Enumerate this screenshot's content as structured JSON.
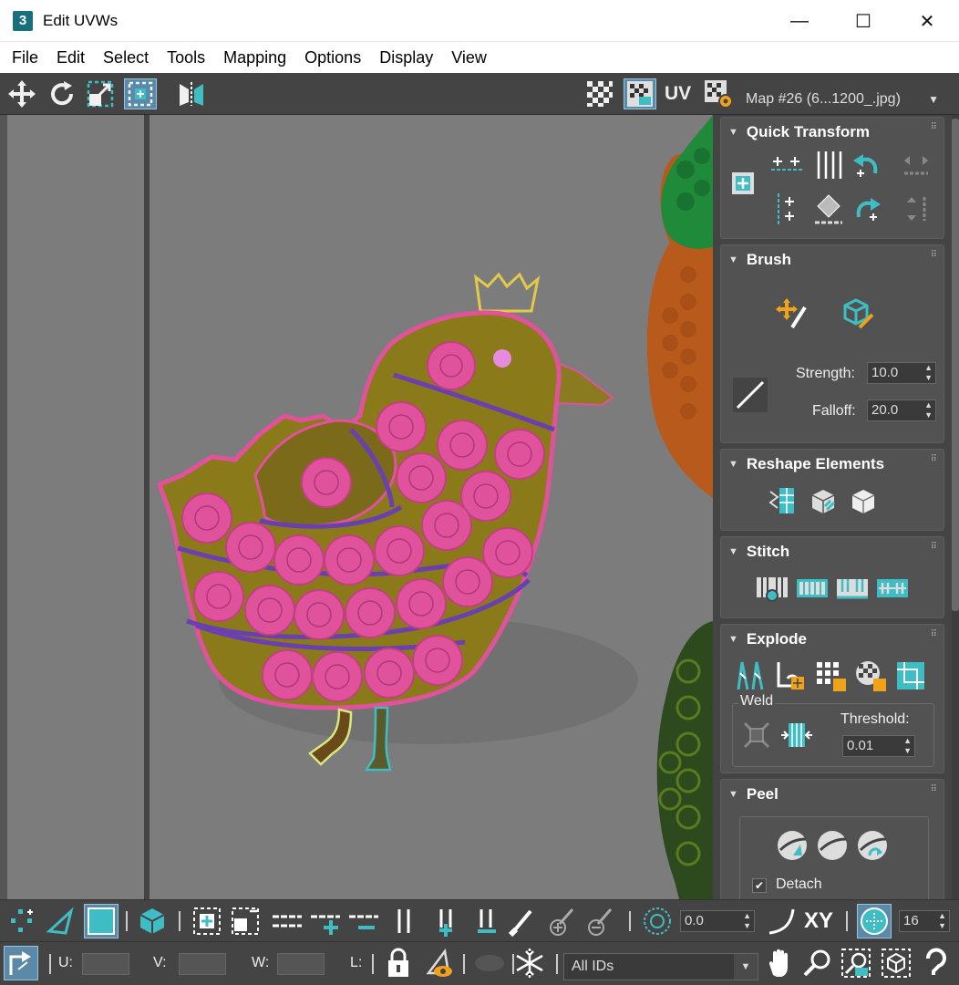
{
  "window": {
    "app_icon": "3",
    "title": "Edit UVWs",
    "minimize_glyph": "—",
    "maximize_glyph": "☐",
    "close_glyph": "✕"
  },
  "menu": [
    "File",
    "Edit",
    "Select",
    "Tools",
    "Mapping",
    "Options",
    "Display",
    "View"
  ],
  "top_toolbar": {
    "uv_label": "UV",
    "map_dropdown": "Map #26 (6...1200_.jpg)"
  },
  "panel": {
    "quick_transform": {
      "title": "Quick Transform"
    },
    "brush": {
      "title": "Brush",
      "strength_label": "Strength:",
      "strength_value": "10.0",
      "falloff_label": "Falloff:",
      "falloff_value": "20.0"
    },
    "reshape": {
      "title": "Reshape Elements"
    },
    "stitch": {
      "title": "Stitch"
    },
    "explode": {
      "title": "Explode",
      "weld_label": "Weld",
      "threshold_label": "Threshold:",
      "threshold_value": "0.01"
    },
    "peel": {
      "title": "Peel",
      "detach_label": "Detach",
      "detach_checked": true
    }
  },
  "bottom_toolbar": {
    "angle_value": "0.0",
    "xy_label": "XY",
    "grid_count": "16",
    "u_label": "U:",
    "v_label": "V:",
    "w_label": "W:",
    "l_label": "L:",
    "ids_dropdown": "All IDs"
  },
  "colors": {
    "accent": "#3fbdc4",
    "selection_pink": "#e0529c",
    "seam_purple": "#6a3fb0",
    "toolbar_bg": "#444444",
    "viewport_bg": "#7c7c7c"
  }
}
